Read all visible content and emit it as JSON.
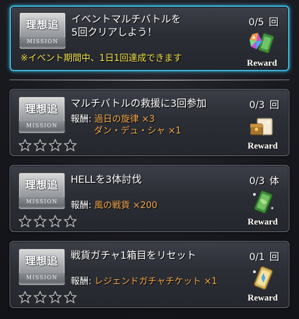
{
  "badge": {
    "kanji": "理想追",
    "mission": "MISSION"
  },
  "missions": [
    {
      "title": "イベントマルチバトルを\n5回クリアしよう！",
      "progress": "0/5",
      "unit": "回",
      "note": "※イベント期間中、1日1回達成できます",
      "reward_button": "Reward",
      "reward_icon": "crystal-ticket-icon"
    },
    {
      "title": "マルチバトルの救援に3回参加",
      "progress": "0/3",
      "unit": "回",
      "reward_label": "報酬:",
      "reward_item": "過日の旋律 ×3",
      "reward_item2": "ダン・デュ・シャ ×1",
      "stars_filled": 0,
      "stars_total": 4,
      "reward_button": "Reward",
      "reward_icon": "treasure-scroll-icon"
    },
    {
      "title": "HELLを3体討伐",
      "progress": "0/3",
      "unit": "体",
      "reward_label": "報酬:",
      "reward_item": "風の戦貨 ×200",
      "stars_filled": 0,
      "stars_total": 4,
      "reward_button": "Reward",
      "reward_icon": "green-ticket-icon"
    },
    {
      "title": "戦貨ガチャ1箱目をリセット",
      "progress": "0/1",
      "unit": "回",
      "reward_label": "報酬:",
      "reward_item": "レジェンドガチャチケット ×1",
      "stars_filled": 0,
      "stars_total": 4,
      "reward_button": "Reward",
      "reward_icon": "gold-ticket-icon"
    }
  ],
  "colors": {
    "event_border": "#3ab3d8",
    "note_text": "#f4e24a",
    "reward_item_text": "#f2a84a",
    "star_empty": "#bfbfbf"
  }
}
